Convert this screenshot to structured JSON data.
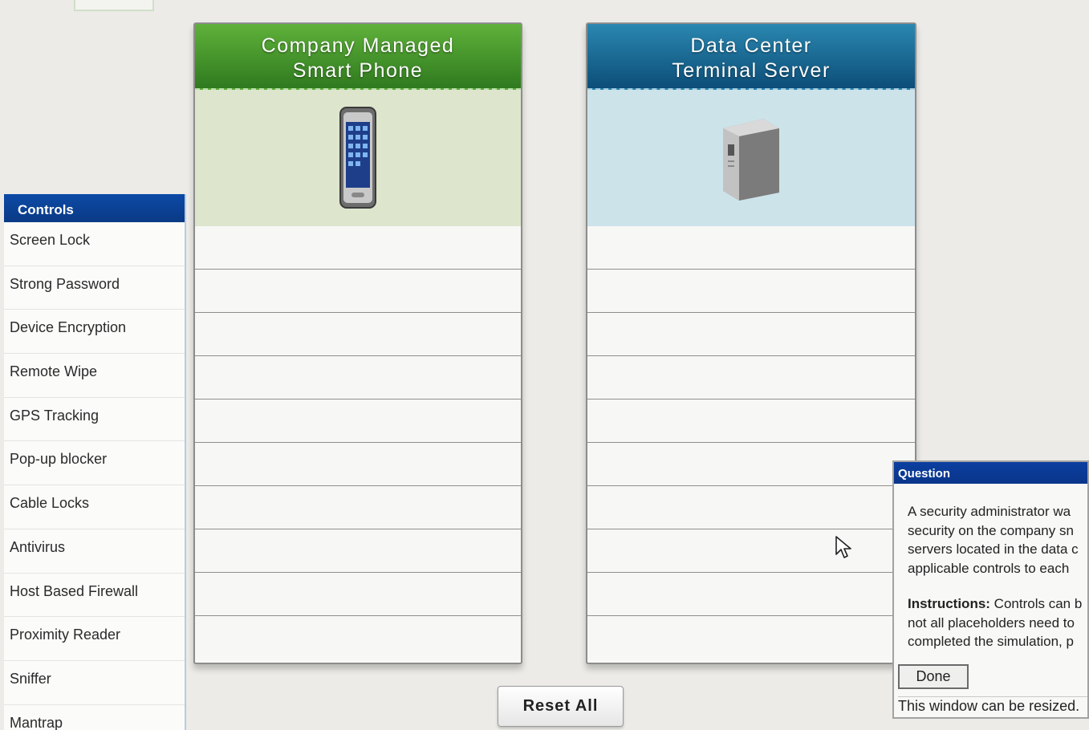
{
  "controls": {
    "title": "Controls",
    "items": [
      {
        "label": "Screen Lock"
      },
      {
        "label": "Strong Password"
      },
      {
        "label": "Device Encryption"
      },
      {
        "label": "Remote Wipe"
      },
      {
        "label": "GPS Tracking"
      },
      {
        "label": "Pop-up blocker"
      },
      {
        "label": "Cable Locks"
      },
      {
        "label": "Antivirus"
      },
      {
        "label": "Host Based Firewall"
      },
      {
        "label": "Proximity Reader"
      },
      {
        "label": "Sniffer"
      },
      {
        "label": "Mantrap"
      }
    ]
  },
  "cards": [
    {
      "title_line1": "Company Managed",
      "title_line2": "Smart Phone",
      "icon": "smartphone-icon",
      "header_color": "#3f8f28",
      "slot_count": 10
    },
    {
      "title_line1": "Data Center",
      "title_line2": "Terminal Server",
      "icon": "server-icon",
      "header_color": "#12608e",
      "slot_count": 10
    }
  ],
  "reset_label": "Reset All",
  "question": {
    "title": "Question",
    "body_lines": [
      "A security administrator wa",
      "security on the company sn",
      "servers located in the data c",
      "applicable controls to each"
    ],
    "instructions_label": "Instructions:",
    "instructions_lines": [
      " Controls can b",
      "not all placeholders need to",
      "completed the simulation, p"
    ],
    "done_label": "Done",
    "resize_note": "This window can be resized."
  },
  "colors": {
    "controls_header": "#0c4aa6",
    "question_title": "#0b3fa0"
  }
}
